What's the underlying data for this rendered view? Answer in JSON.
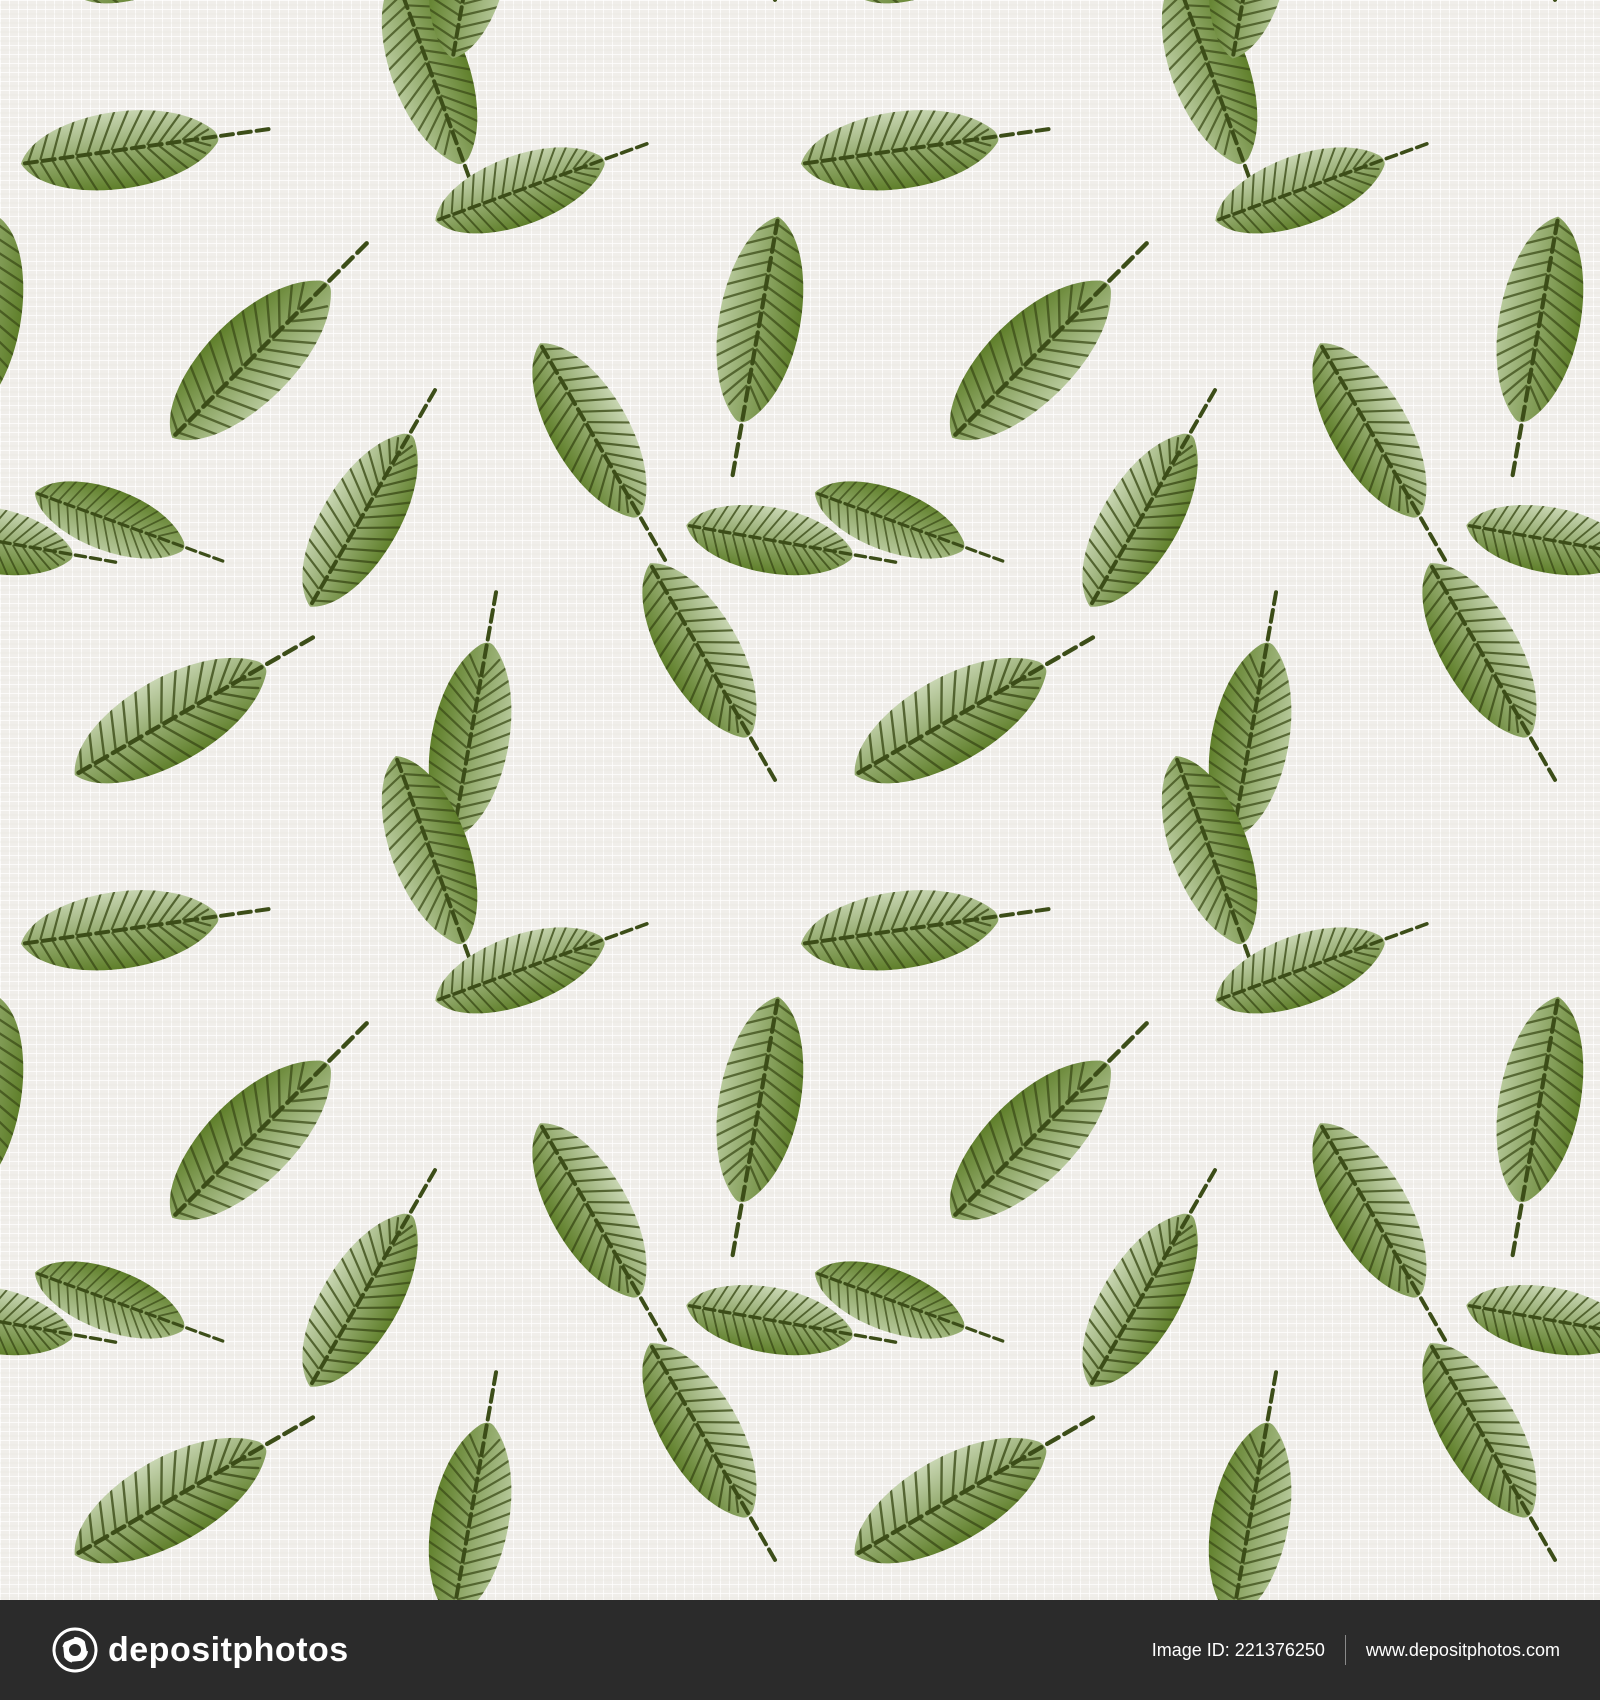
{
  "image": {
    "subject": "Seamless embroidered green leaf pattern on linen",
    "background_color": "#f0eeea",
    "leaf_colors": [
      "#5f7f2a",
      "#7d9a48",
      "#a3b982",
      "#c8d6b2"
    ],
    "stitch_color": "#2f3a14"
  },
  "footer": {
    "brand": "depositphotos",
    "brand_icon": "camera-aperture-icon",
    "image_id_label": "Image ID:",
    "image_id": "221376250",
    "site": "www.depositphotos.com"
  }
}
